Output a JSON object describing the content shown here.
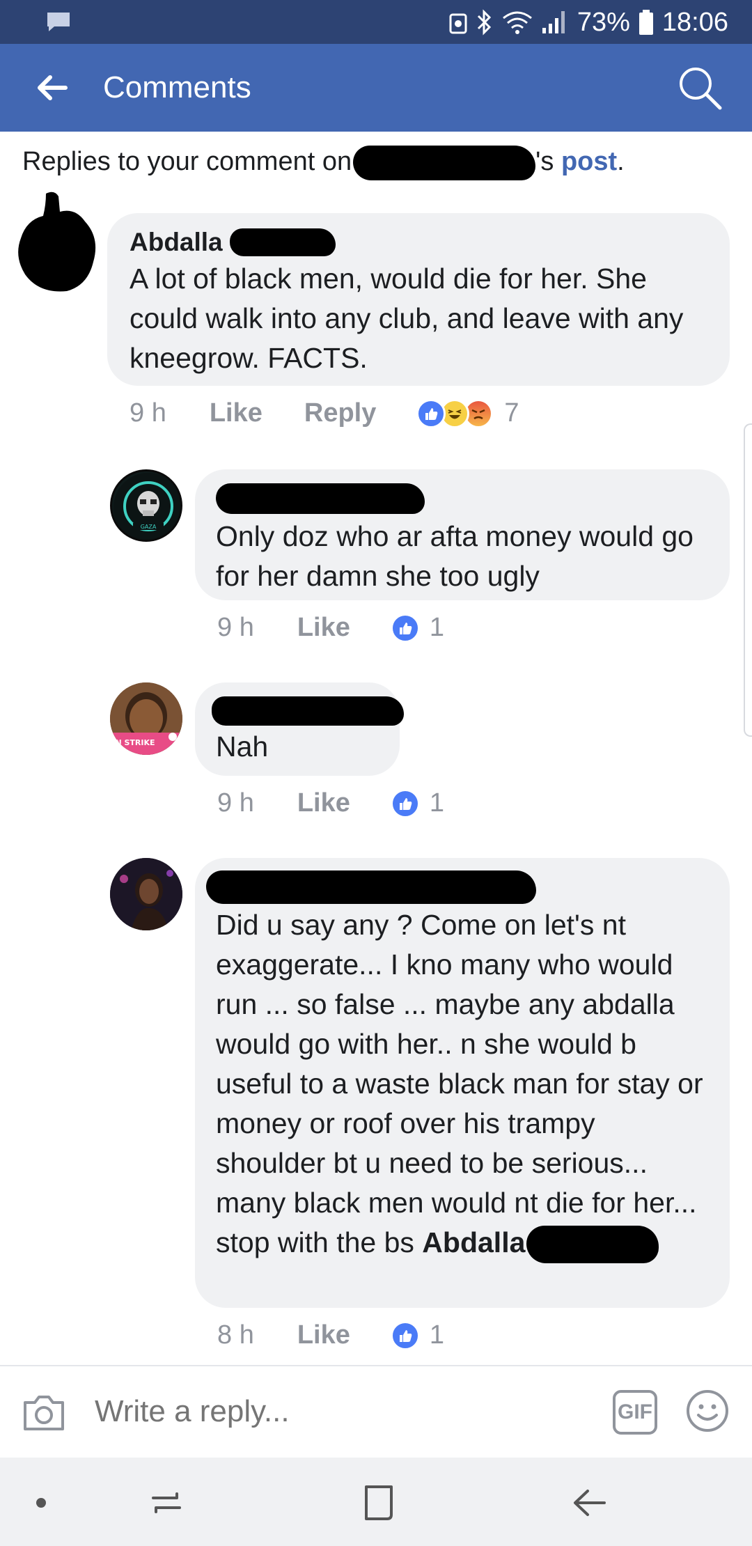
{
  "status_bar": {
    "battery_percent": "73%",
    "time": "18:06"
  },
  "header": {
    "title": "Comments"
  },
  "replies_line": {
    "prefix": "Replies to your comment on",
    "suffix": "'s",
    "post_link": "post",
    "period": "."
  },
  "comments": [
    {
      "name": "Abdalla",
      "text": "A lot of black men, would die for her. She could walk into any club, and leave with any kneegrow. FACTS.",
      "time": "9 h",
      "like_label": "Like",
      "reply_label": "Reply",
      "reaction_count": "7",
      "reactions": [
        "like-icon",
        "haha-icon",
        "angry-icon"
      ]
    },
    {
      "name": "",
      "text": "Only doz who ar afta money would go for her damn she too ugly",
      "time": "9 h",
      "like_label": "Like",
      "reaction_count": "1",
      "avatar_badge": "GAZA"
    },
    {
      "name": "",
      "text": "Nah",
      "time": "9 h",
      "like_label": "Like",
      "reaction_count": "1",
      "avatar_badge": "N STRIKE"
    },
    {
      "name": "",
      "text": "Did u say any ? Come on let's nt exaggerate... I kno many who would run ... so false ... maybe any abdalla would go with her.. n she would b useful to a waste black man for stay or money or roof over his trampy shoulder bt u need to be serious... many black men would nt die for her... stop with the bs",
      "mention": "Abdalla",
      "time": "8 h",
      "like_label": "Like",
      "reaction_count": "1"
    }
  ],
  "composer": {
    "placeholder": "Write a reply...",
    "gif_label": "GIF"
  },
  "colors": {
    "status_bar": "#2d4373",
    "header": "#4267b2",
    "bubble": "#f0f1f3",
    "like_blue": "#4a7bf7",
    "meta_gray": "#90949c"
  }
}
